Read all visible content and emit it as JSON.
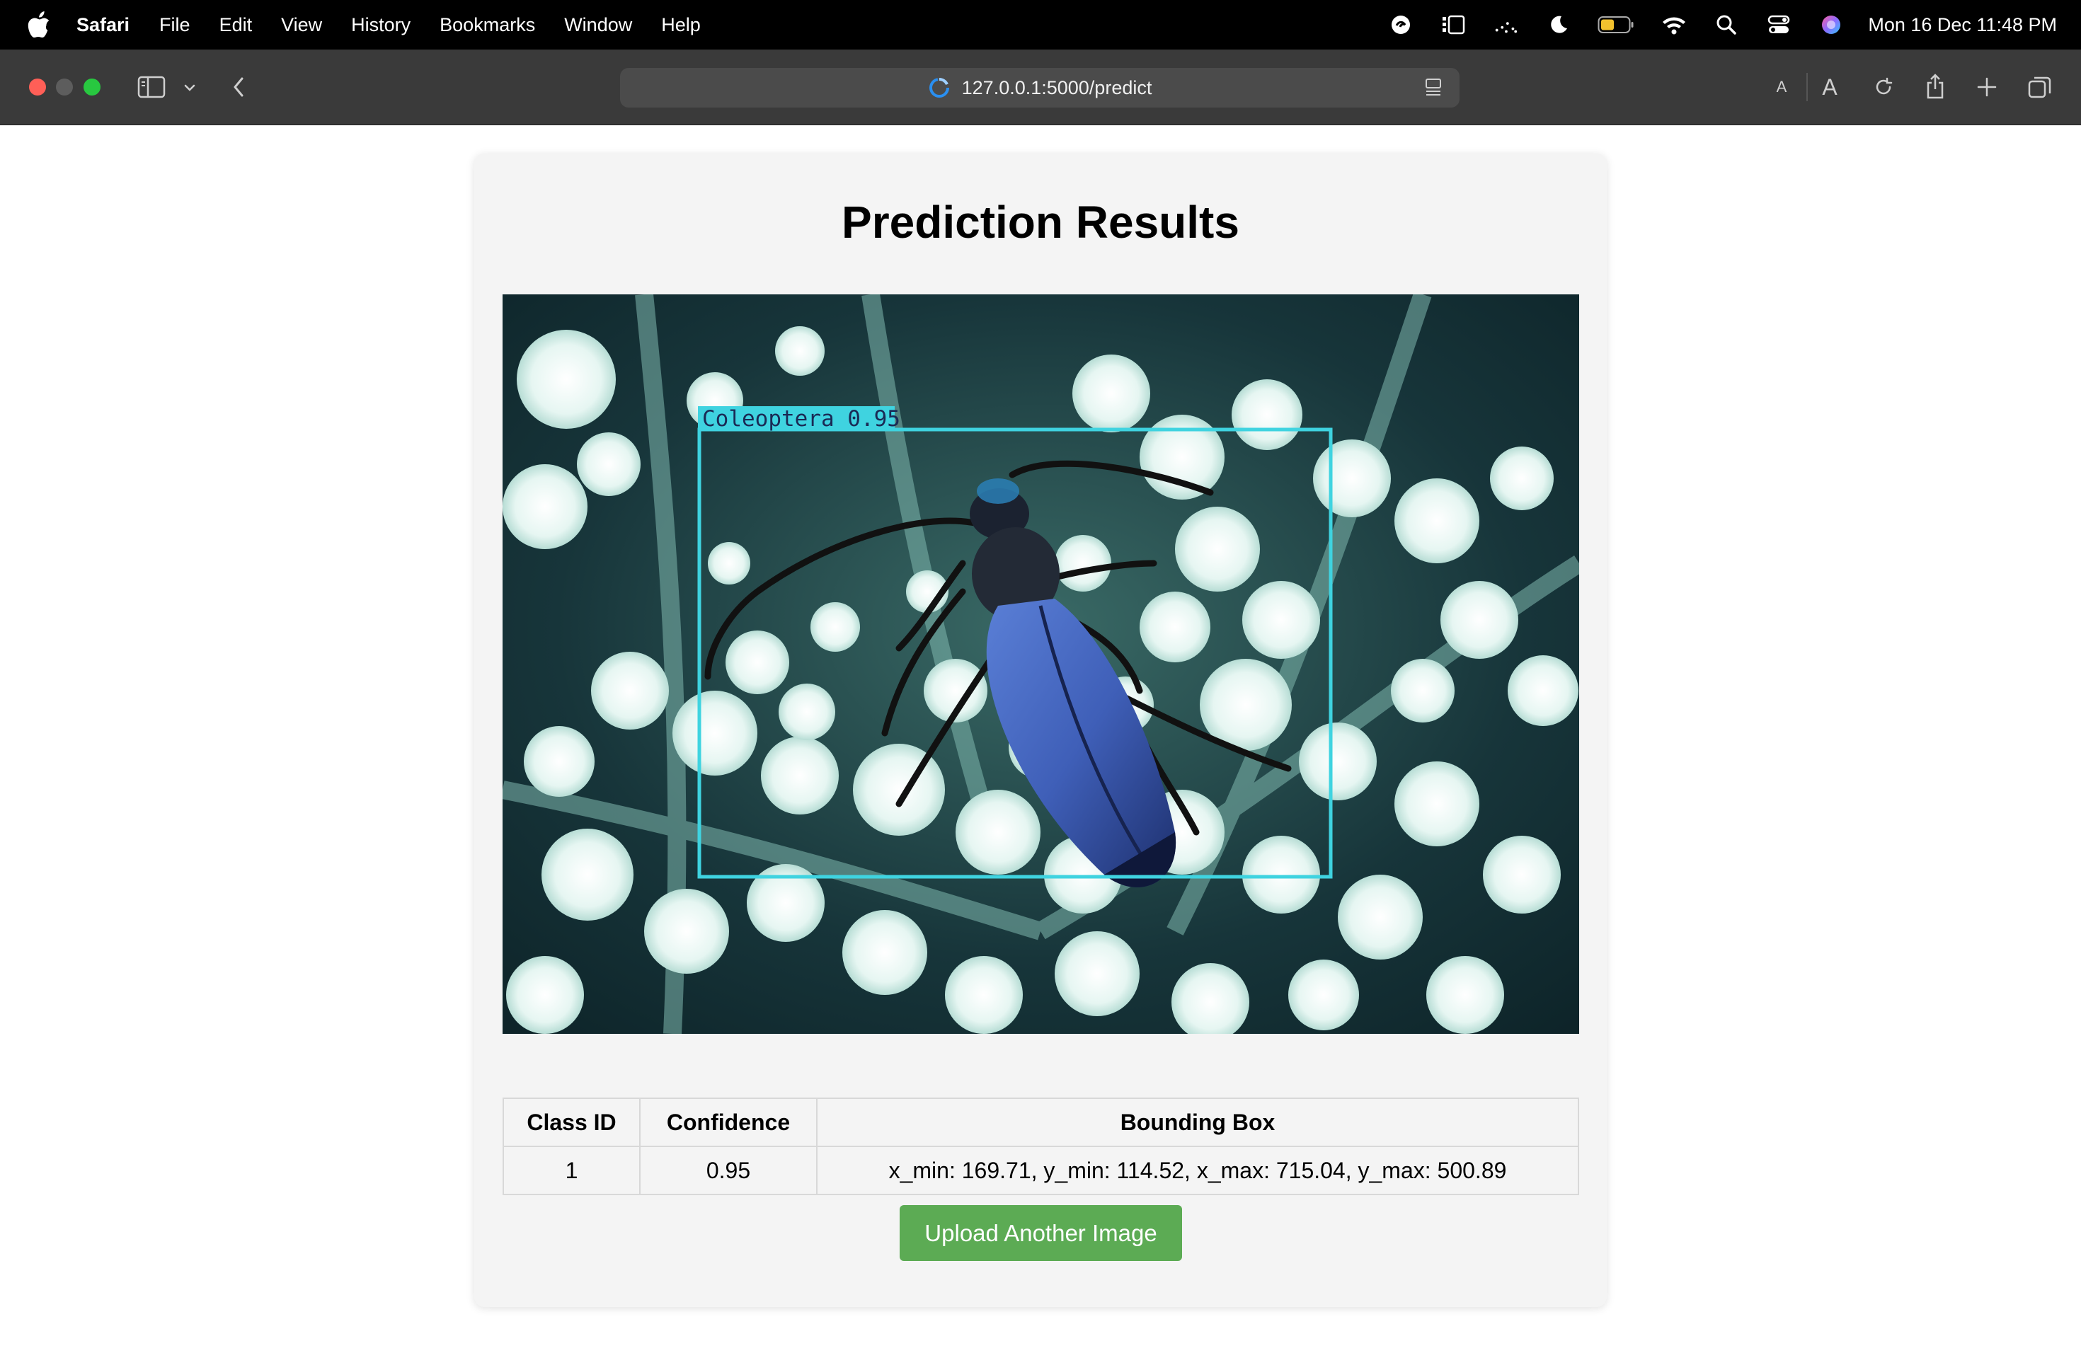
{
  "menubar": {
    "app_name": "Safari",
    "items": [
      "File",
      "Edit",
      "View",
      "History",
      "Bookmarks",
      "Window",
      "Help"
    ],
    "clock": "Mon 16 Dec  11:48 PM",
    "status_icons": [
      "screen-recording-icon",
      "stage-manager-icon",
      "weather-icon",
      "focus-moon-icon",
      "battery-icon",
      "wifi-icon",
      "spotlight-search-icon",
      "control-center-icon",
      "siri-icon"
    ]
  },
  "browser": {
    "url": "127.0.0.1:5000/predict",
    "loading": true,
    "text_size_small": "A",
    "text_size_large": "A"
  },
  "page": {
    "title": "Prediction Results",
    "image_label": "Coleoptera 0.95",
    "box_color": "#3fd3e0",
    "table": {
      "headers": [
        "Class ID",
        "Confidence",
        "Bounding Box"
      ],
      "rows": [
        [
          "1",
          "0.95",
          "x_min: 169.71, y_min: 114.52, x_max: 715.04, y_max: 500.89"
        ]
      ]
    },
    "upload_button": "Upload Another Image"
  },
  "colors": {
    "menubar_bg": "#000000",
    "toolbar_bg": "#3a3a3a",
    "card_bg": "#f4f4f4",
    "button_green": "#5cab54"
  }
}
